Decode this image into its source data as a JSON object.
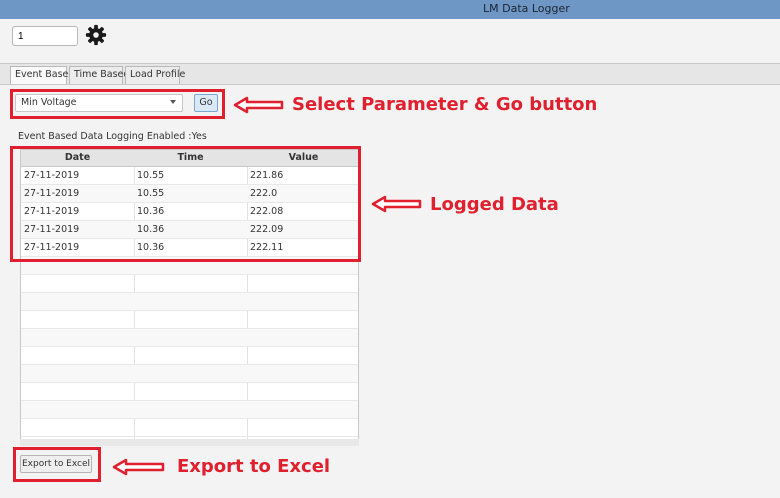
{
  "window": {
    "title": "LM Data Logger"
  },
  "toolbar": {
    "id_value": "1",
    "settings_icon": "gear-icon"
  },
  "tabs": [
    {
      "label": "Event Based",
      "active": true
    },
    {
      "label": "Time Based",
      "active": false
    },
    {
      "label": "Load Profile",
      "active": false
    }
  ],
  "controls": {
    "parameter_selected": "Min Voltage",
    "go_label": "Go"
  },
  "status_text": "Event Based Data Logging Enabled :Yes",
  "table": {
    "columns": [
      "Date",
      "Time",
      "Value"
    ],
    "rows": [
      [
        "27-11-2019",
        "10.55",
        "221.86"
      ],
      [
        "27-11-2019",
        "10.55",
        "222.0"
      ],
      [
        "27-11-2019",
        "10.36",
        "222.08"
      ],
      [
        "27-11-2019",
        "10.36",
        "222.09"
      ],
      [
        "27-11-2019",
        "10.36",
        "222.11"
      ]
    ]
  },
  "export_label": "Export to Excel",
  "annotations": {
    "select_go": "Select Parameter & Go button",
    "logged_data": "Logged Data",
    "export": "Export to Excel"
  },
  "colors": {
    "titlebar": "#6f97c6",
    "annotation": "#e0202e",
    "go_button": "#dbe9f6"
  }
}
